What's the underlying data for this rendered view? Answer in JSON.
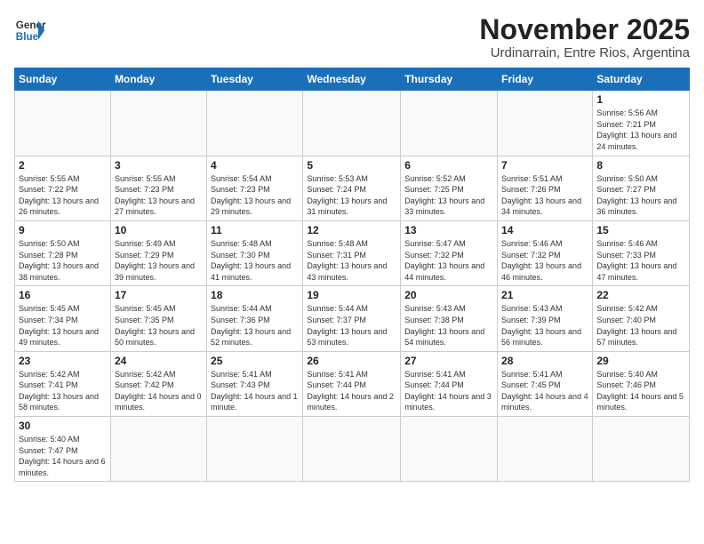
{
  "logo": {
    "line1": "General",
    "line2": "Blue"
  },
  "title": "November 2025",
  "location": "Urdinarrain, Entre Rios, Argentina",
  "weekdays": [
    "Sunday",
    "Monday",
    "Tuesday",
    "Wednesday",
    "Thursday",
    "Friday",
    "Saturday"
  ],
  "days": {
    "1": {
      "sunrise": "5:56 AM",
      "sunset": "7:21 PM",
      "daylight": "13 hours and 24 minutes."
    },
    "2": {
      "sunrise": "5:55 AM",
      "sunset": "7:22 PM",
      "daylight": "13 hours and 26 minutes."
    },
    "3": {
      "sunrise": "5:55 AM",
      "sunset": "7:23 PM",
      "daylight": "13 hours and 27 minutes."
    },
    "4": {
      "sunrise": "5:54 AM",
      "sunset": "7:23 PM",
      "daylight": "13 hours and 29 minutes."
    },
    "5": {
      "sunrise": "5:53 AM",
      "sunset": "7:24 PM",
      "daylight": "13 hours and 31 minutes."
    },
    "6": {
      "sunrise": "5:52 AM",
      "sunset": "7:25 PM",
      "daylight": "13 hours and 33 minutes."
    },
    "7": {
      "sunrise": "5:51 AM",
      "sunset": "7:26 PM",
      "daylight": "13 hours and 34 minutes."
    },
    "8": {
      "sunrise": "5:50 AM",
      "sunset": "7:27 PM",
      "daylight": "13 hours and 36 minutes."
    },
    "9": {
      "sunrise": "5:50 AM",
      "sunset": "7:28 PM",
      "daylight": "13 hours and 38 minutes."
    },
    "10": {
      "sunrise": "5:49 AM",
      "sunset": "7:29 PM",
      "daylight": "13 hours and 39 minutes."
    },
    "11": {
      "sunrise": "5:48 AM",
      "sunset": "7:30 PM",
      "daylight": "13 hours and 41 minutes."
    },
    "12": {
      "sunrise": "5:48 AM",
      "sunset": "7:31 PM",
      "daylight": "13 hours and 43 minutes."
    },
    "13": {
      "sunrise": "5:47 AM",
      "sunset": "7:32 PM",
      "daylight": "13 hours and 44 minutes."
    },
    "14": {
      "sunrise": "5:46 AM",
      "sunset": "7:32 PM",
      "daylight": "13 hours and 46 minutes."
    },
    "15": {
      "sunrise": "5:46 AM",
      "sunset": "7:33 PM",
      "daylight": "13 hours and 47 minutes."
    },
    "16": {
      "sunrise": "5:45 AM",
      "sunset": "7:34 PM",
      "daylight": "13 hours and 49 minutes."
    },
    "17": {
      "sunrise": "5:45 AM",
      "sunset": "7:35 PM",
      "daylight": "13 hours and 50 minutes."
    },
    "18": {
      "sunrise": "5:44 AM",
      "sunset": "7:36 PM",
      "daylight": "13 hours and 52 minutes."
    },
    "19": {
      "sunrise": "5:44 AM",
      "sunset": "7:37 PM",
      "daylight": "13 hours and 53 minutes."
    },
    "20": {
      "sunrise": "5:43 AM",
      "sunset": "7:38 PM",
      "daylight": "13 hours and 54 minutes."
    },
    "21": {
      "sunrise": "5:43 AM",
      "sunset": "7:39 PM",
      "daylight": "13 hours and 56 minutes."
    },
    "22": {
      "sunrise": "5:42 AM",
      "sunset": "7:40 PM",
      "daylight": "13 hours and 57 minutes."
    },
    "23": {
      "sunrise": "5:42 AM",
      "sunset": "7:41 PM",
      "daylight": "13 hours and 58 minutes."
    },
    "24": {
      "sunrise": "5:42 AM",
      "sunset": "7:42 PM",
      "daylight": "14 hours and 0 minutes."
    },
    "25": {
      "sunrise": "5:41 AM",
      "sunset": "7:43 PM",
      "daylight": "14 hours and 1 minute."
    },
    "26": {
      "sunrise": "5:41 AM",
      "sunset": "7:44 PM",
      "daylight": "14 hours and 2 minutes."
    },
    "27": {
      "sunrise": "5:41 AM",
      "sunset": "7:44 PM",
      "daylight": "14 hours and 3 minutes."
    },
    "28": {
      "sunrise": "5:41 AM",
      "sunset": "7:45 PM",
      "daylight": "14 hours and 4 minutes."
    },
    "29": {
      "sunrise": "5:40 AM",
      "sunset": "7:46 PM",
      "daylight": "14 hours and 5 minutes."
    },
    "30": {
      "sunrise": "5:40 AM",
      "sunset": "7:47 PM",
      "daylight": "14 hours and 6 minutes."
    }
  }
}
